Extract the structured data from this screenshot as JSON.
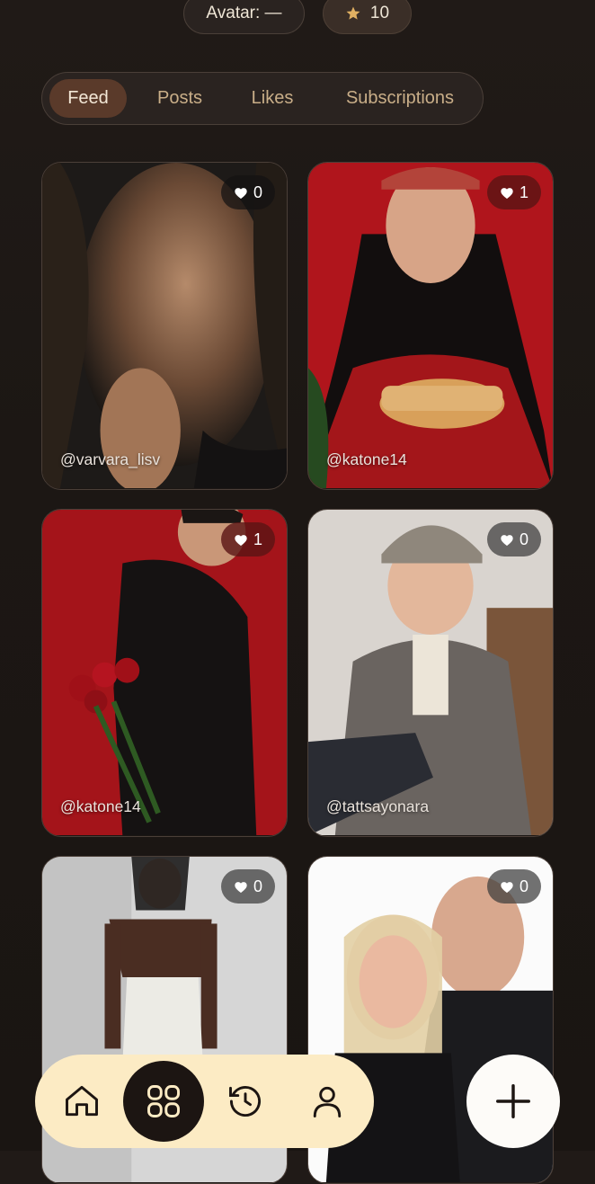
{
  "header": {
    "avatar_label": "Avatar: —",
    "stars_count": "10"
  },
  "tabs": [
    {
      "label": "Feed",
      "active": true
    },
    {
      "label": "Posts",
      "active": false
    },
    {
      "label": "Likes",
      "active": false
    },
    {
      "label": "Subscriptions",
      "active": false
    }
  ],
  "feed": [
    {
      "handle": "@varvara_lisv",
      "likes": "0"
    },
    {
      "handle": "@katone14",
      "likes": "1"
    },
    {
      "handle": "@katone14",
      "likes": "1"
    },
    {
      "handle": "@tattsayonara",
      "likes": "0"
    },
    {
      "handle": "@...",
      "likes": "0"
    },
    {
      "handle": "@...",
      "likes": "0"
    }
  ],
  "nav": {
    "items": [
      "home-icon",
      "grid-icon",
      "history-icon",
      "profile-icon"
    ],
    "active": "grid-icon"
  },
  "fab": {
    "icon": "plus-icon"
  },
  "colors": {
    "background": "#1c1714",
    "accent_tab": "#5a3a2a",
    "nav_bg": "#fcebc4",
    "star": "#e0b062"
  }
}
